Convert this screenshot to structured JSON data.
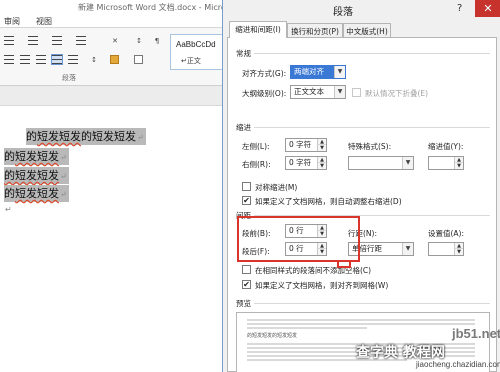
{
  "word": {
    "title": "新建 Microsoft Word 文档.docx - Microso",
    "tabs": [
      "审阅",
      "视图"
    ],
    "style_sample": "AaBbCcDd",
    "style_name": "↵正文",
    "group_label": "段落",
    "doc_lines": [
      {
        "pre": "的",
        "parts": [
          "短发短发",
          "的短发短发"
        ],
        "mark": "↵"
      },
      {
        "pre": "的",
        "parts": [
          "短发短发"
        ],
        "mark": "↵"
      },
      {
        "pre": "",
        "parts": [
          "的短发短发"
        ],
        "mark": "↵"
      },
      {
        "pre": "的",
        "parts": [
          "短发短发"
        ],
        "mark": "↵"
      }
    ],
    "empty_mark": "↵"
  },
  "dialog": {
    "title": "段落",
    "help": "?",
    "close": "✕",
    "tabs": [
      "缩进和间距(I)",
      "换行和分页(P)",
      "中文版式(H)"
    ],
    "general": {
      "heading": "常规",
      "alignment_label": "对齐方式(G):",
      "alignment_value": "两端对齐",
      "outline_label": "大纲级别(O):",
      "outline_value": "正文文本",
      "collapsed_label": "默认情况下折叠(E)"
    },
    "indent": {
      "heading": "缩进",
      "left_label": "左侧(L):",
      "left_value": "0 字符",
      "right_label": "右侧(R):",
      "right_value": "0 字符",
      "special_label": "特殊格式(S):",
      "special_value": "",
      "indent_by_label": "缩进值(Y):",
      "indent_by_value": "",
      "mirror_label": "对称缩进(M)",
      "auto_adjust_label": "如果定义了文档网格，则自动调整右缩进(D)"
    },
    "spacing": {
      "heading": "间距",
      "before_label": "段前(B):",
      "before_value": "0 行",
      "after_label": "段后(F):",
      "after_value": "0 行",
      "line_label": "行距(N):",
      "line_value": "单倍行距",
      "at_label": "设置值(A):",
      "at_value": "",
      "no_space_label": "在相同样式的段落间不添加空格(C)",
      "snap_grid_label": "如果定义了文档网格，则对齐到网格(W)"
    },
    "preview_heading": "预览",
    "preview_sample": "的短发短发的短发短发"
  },
  "watermark": {
    "domain": "jb51.net",
    "text": "查字典 教程网",
    "site": "jiaocheng.chazidian.com"
  },
  "colors": {
    "highlight": "#3a78d6",
    "red_annotation": "#d9352c",
    "close_button": "#c7332c"
  }
}
